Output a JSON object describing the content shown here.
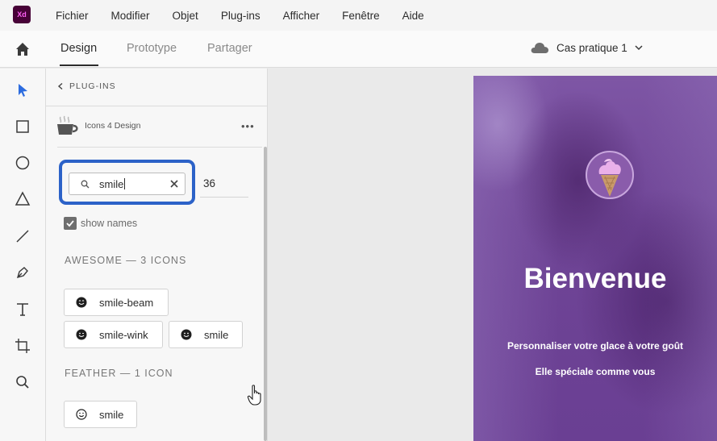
{
  "app": {
    "logo_text": "Xd"
  },
  "menu": [
    "Fichier",
    "Modifier",
    "Objet",
    "Plug-ins",
    "Afficher",
    "Fenêtre",
    "Aide"
  ],
  "tabs": {
    "design": "Design",
    "prototype": "Prototype",
    "share": "Partager",
    "active": "Design"
  },
  "document": {
    "name": "Cas pratique 1"
  },
  "tools": [
    "select-tool",
    "rectangle-tool",
    "ellipse-tool",
    "polygon-tool",
    "line-tool",
    "pen-tool",
    "text-tool",
    "artboard-tool",
    "zoom-tool"
  ],
  "panel": {
    "back_label": "PLUG-INS",
    "plugin_name": "Icons 4 Design",
    "more": "•••",
    "search": {
      "value": "smile",
      "result_count": "36"
    },
    "show_names": {
      "label": "show names",
      "checked": true
    },
    "sections": [
      {
        "title": "AWESOME — 3 ICONS",
        "icons": [
          "smile-beam",
          "smile-wink",
          "smile"
        ]
      },
      {
        "title": "FEATHER — 1 ICON",
        "icons": [
          "smile"
        ]
      }
    ]
  },
  "artboard": {
    "title": "Bienvenue",
    "line1": "Personnaliser votre glace à votre goût",
    "line2": "Elle spéciale comme vous"
  },
  "colors": {
    "highlight": "#2c62c8",
    "artboard_purple": "#6f4596",
    "logo_pink": "#e9a8e8",
    "xd_brand": "#470137"
  }
}
